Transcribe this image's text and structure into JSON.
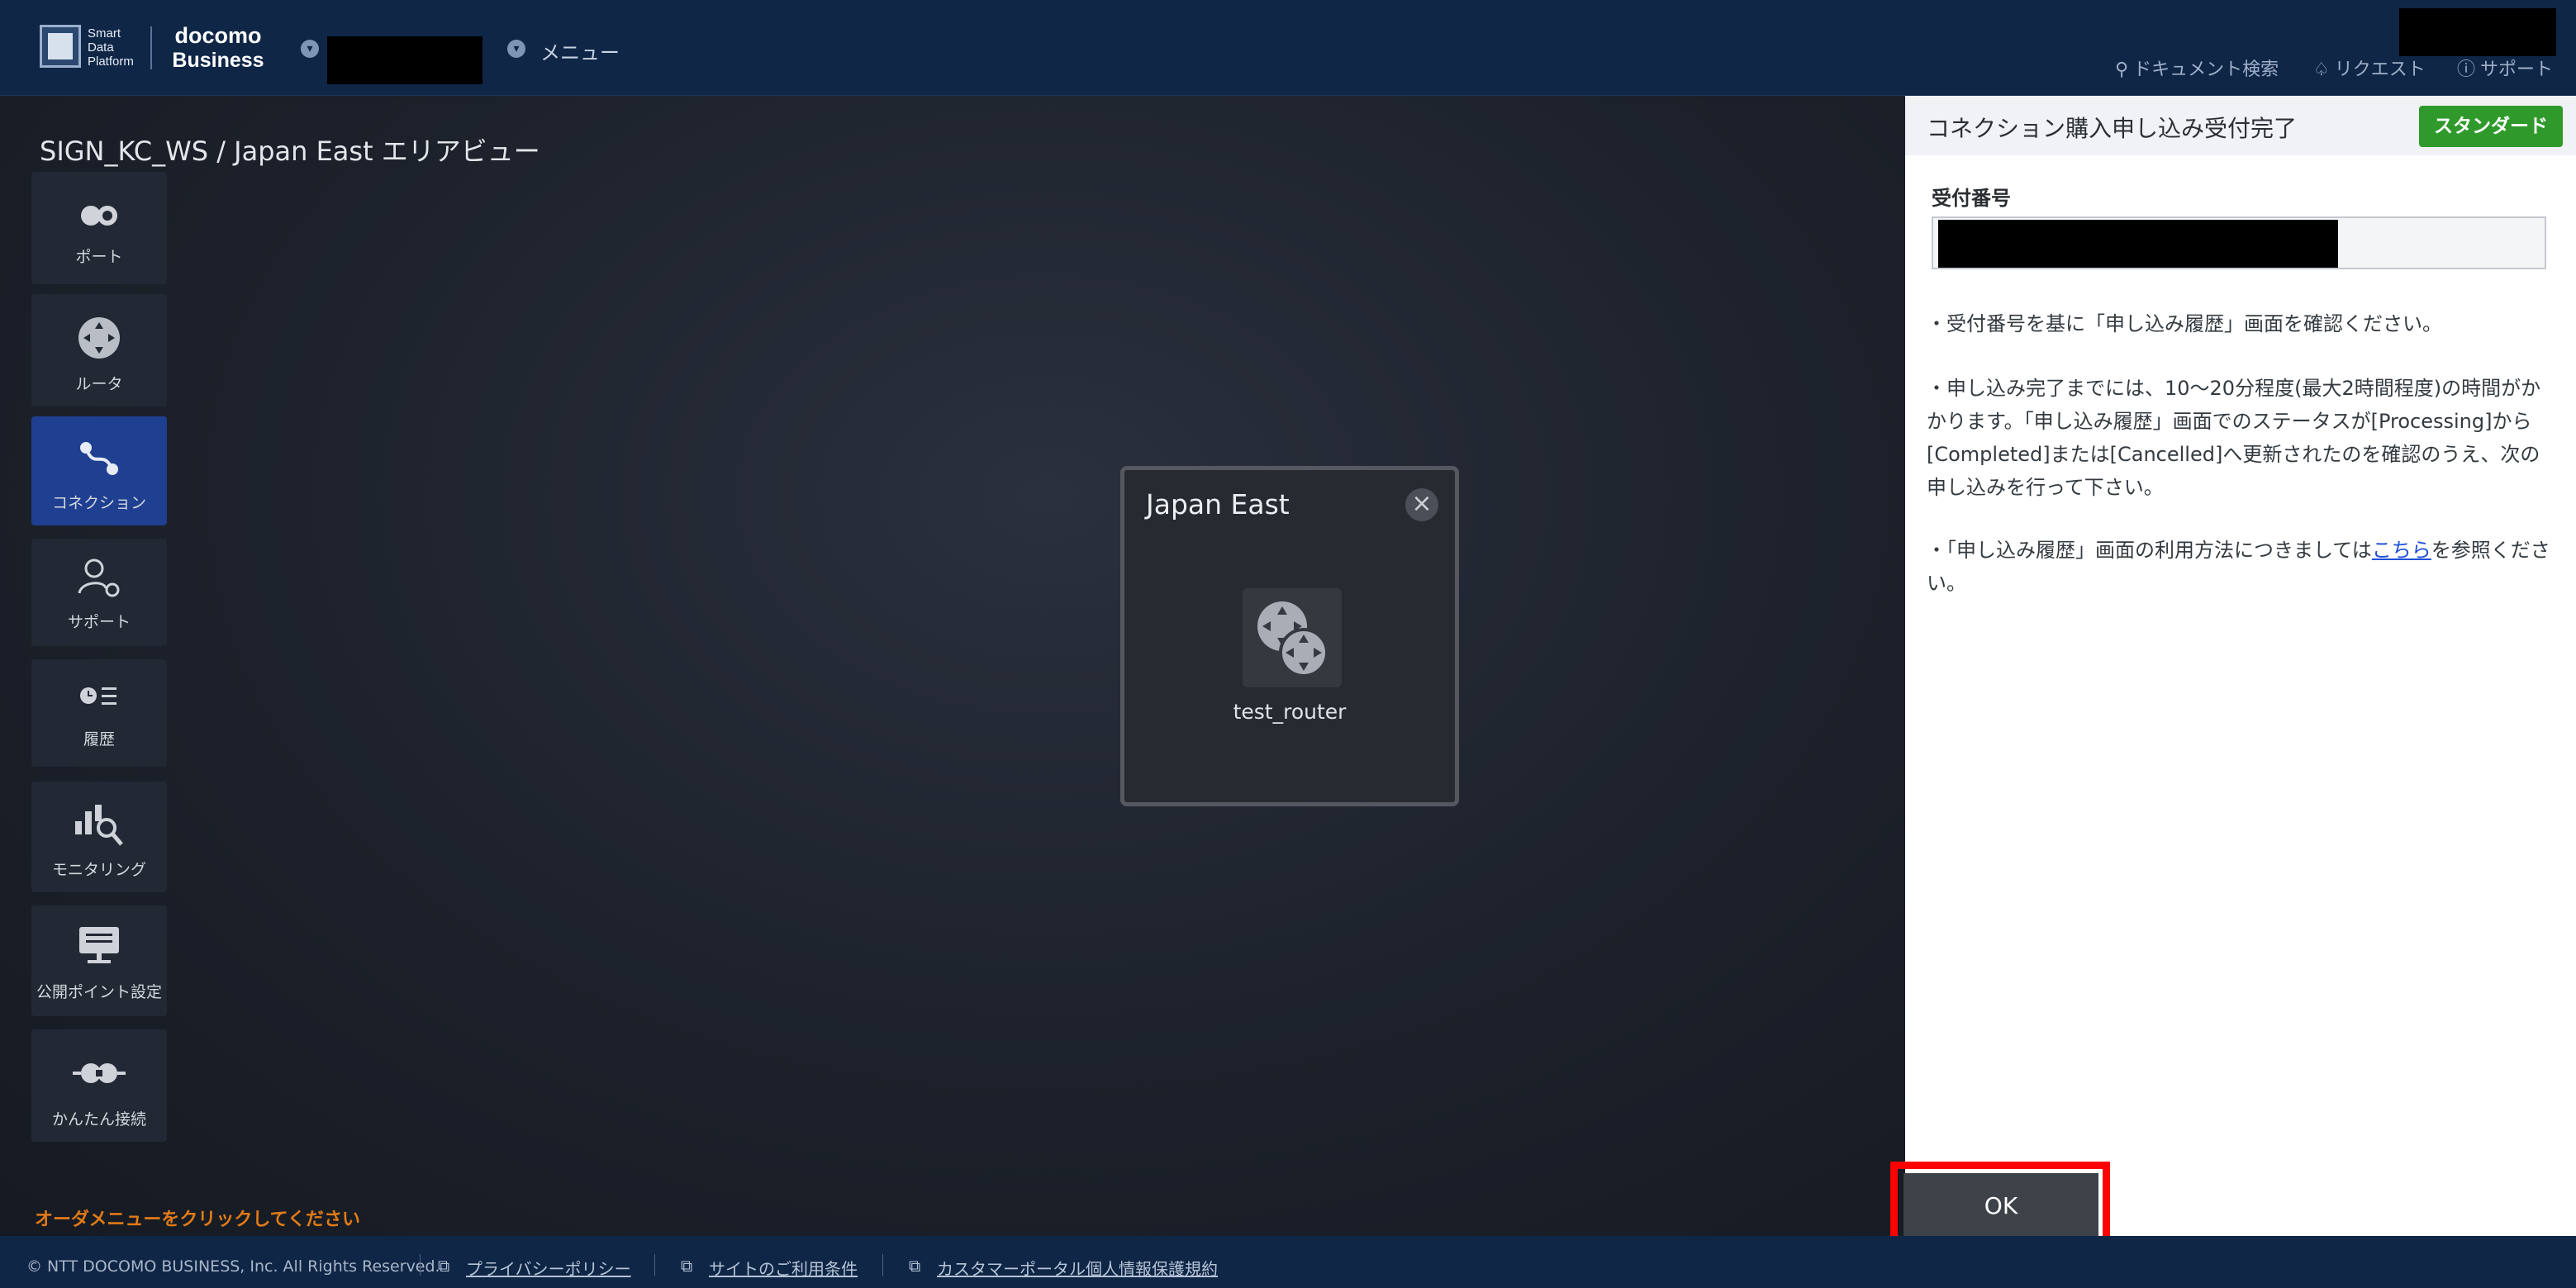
{
  "header": {
    "logo_sdp": "Smart Data Platform",
    "logo_docomo_line1": "docomo",
    "logo_docomo_line2": "Business",
    "menu_label": "メニュー",
    "nav": {
      "doc_search": "ドキュメント検索",
      "request": "リクエスト",
      "support": "サポート"
    }
  },
  "canvas": {
    "title": "SIGN_KC_WS / Japan East エリアビュー",
    "order_hint": "オーダメニューをクリックしてください"
  },
  "sidebar": {
    "items": [
      {
        "label": "ポート",
        "icon": "port-icon"
      },
      {
        "label": "ルータ",
        "icon": "router-icon"
      },
      {
        "label": "コネクション",
        "icon": "connection-icon"
      },
      {
        "label": "サポート",
        "icon": "support-icon"
      },
      {
        "label": "履歴",
        "icon": "history-icon"
      },
      {
        "label": "モニタリング",
        "icon": "monitoring-icon"
      },
      {
        "label": "公開ポイント設定",
        "icon": "public-point-icon"
      },
      {
        "label": "かんたん接続",
        "icon": "easy-connect-icon"
      }
    ]
  },
  "popup": {
    "title": "Japan East",
    "router_name": "test_router"
  },
  "panel": {
    "title": "コネクション購入申し込み受付完了",
    "badge": "スタンダード",
    "field_label": "受付番号",
    "note1": "・受付番号を基に「申し込み履歴」画面を確認ください。",
    "note2": "・申し込み完了までには、10〜20分程度(最大2時間程度)の時間がかかります。「申し込み履歴」画面でのステータスが[Processing]から[Completed]または[Cancelled]へ更新されたのを確認のうえ、次の申し込みを行って下さい。",
    "note3_pre": "・「申し込み履歴」画面の利用方法につきましては",
    "note3_link": "こちら",
    "note3_post": "を参照ください。",
    "ok_label": "OK"
  },
  "footer": {
    "copyright": "© NTT DOCOMO BUSINESS, Inc. All Rights Reserved.",
    "links": [
      "プライバシーポリシー",
      "サイトのご利用条件",
      "カスタマーポータル個人情報保護規約"
    ]
  },
  "colors": {
    "header_bg": "#0f2647",
    "active_tile": "#1f3f91",
    "badge_green": "#2f9a2b",
    "hint_orange": "#e07a17",
    "link_blue": "#1e4fd8",
    "highlight_red": "#ff0000"
  }
}
